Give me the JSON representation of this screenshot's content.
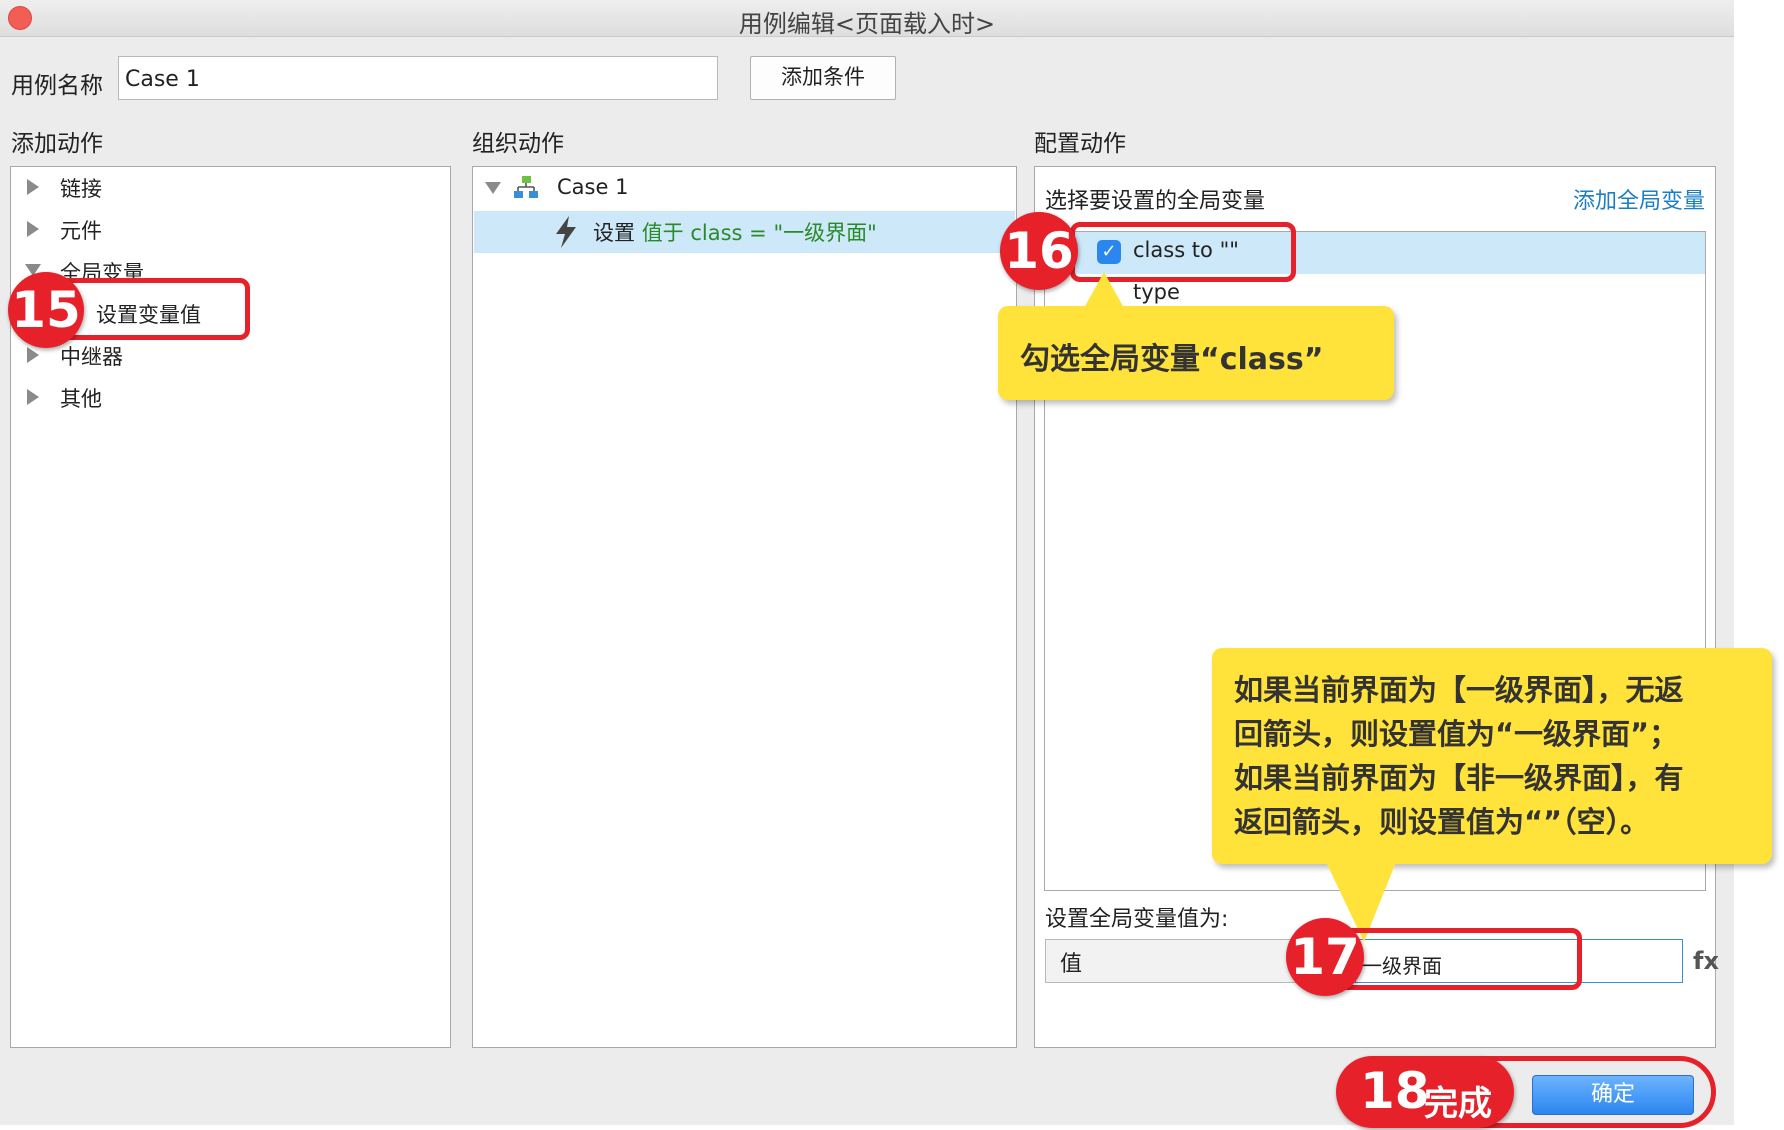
{
  "window": {
    "title": "用例编辑<页面载入时>"
  },
  "case_name": {
    "label": "用例名称",
    "value": "Case 1"
  },
  "add_condition_button": "添加条件",
  "sections": {
    "add_actions": "添加动作",
    "organize_actions": "组织动作",
    "configure_actions": "配置动作"
  },
  "add_actions_tree": [
    {
      "label": "链接"
    },
    {
      "label": "元件"
    },
    {
      "label": "全局变量"
    },
    {
      "label": "设置变量值"
    },
    {
      "label": "中继器"
    },
    {
      "label": "其他"
    }
  ],
  "organize": {
    "case_label": "Case 1",
    "action_prefix": "设置",
    "action_detail": "值于 class = \"一级界面\""
  },
  "configure": {
    "header": "选择要设置的全局变量",
    "add_var_link": "添加全局变量",
    "variables": [
      {
        "name": "class to \"\"",
        "checked": true
      },
      {
        "name": "type",
        "checked": false
      }
    ],
    "set_value_label": "设置全局变量值为:",
    "value_type": "值",
    "value": "一级界面",
    "fx": "fx"
  },
  "ok_button": "确定",
  "annotations": {
    "step15": "15",
    "step16": "16",
    "step17": "17",
    "step18": "18",
    "step18_text": "完成",
    "callout16": "勾选全局变量“class”",
    "callout17_lines": [
      "如果当前界面为【一级界面】，无返",
      "回箭头，则设置值为“一级界面”；",
      "如果当前界面为【非一级界面】，有",
      "返回箭头，则设置值为“”（空）。"
    ]
  },
  "colors": {
    "accent_red": "#e7212a",
    "callout_yellow": "#ffe33a",
    "selection": "#cde8f8",
    "link_blue": "#1b7fc6"
  }
}
